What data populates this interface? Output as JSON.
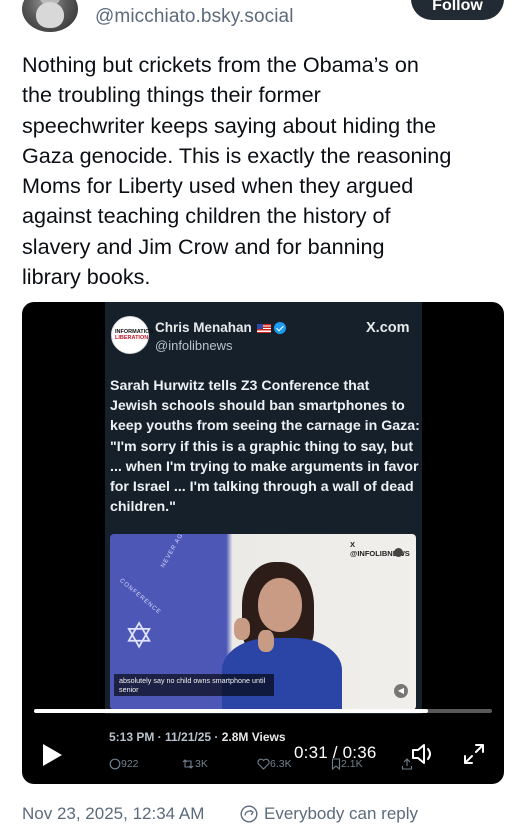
{
  "header": {
    "handle": "@micchiato.bsky.social",
    "follow_label": "Follow"
  },
  "post": {
    "text": "Nothing but crickets from the Obama’s on\nthe troubling things their former\nspeechwriter keeps saying about hiding the\nGaza genocide. This is exactly the reasoning\nMoms for Liberty used when they argued\nagainst teaching children the history of\nslavery and Jim Crow and for banning\nlibrary books."
  },
  "embed": {
    "avatar_line1": "INFORMATION",
    "avatar_line2": "LIBERATION",
    "author_name": "Chris Menahan",
    "author_handle": "@infolibnews",
    "site": "X.com",
    "headline": "Sarah Hurwitz tells Z3 Conference that Jewish schools should ban smartphones to keep youths from seeing the carnage in Gaza: \"I'm sorry if this is a graphic thing to say, but ... when I'm trying to make arguments in favor for Israel ... I'm talking through a wall of dead children.\"",
    "watermark": "X @INFOLIBNEWS",
    "banner_top": "NEVER AGAIN",
    "banner_side": "CONFERENCE",
    "caption": "absolutely say no child owns smartphone until senior",
    "meta_time": "5:13 PM · 11/21/25 · ",
    "meta_views": "2.8M Views",
    "stats": {
      "replies": "922",
      "reposts": "3K",
      "likes": "6.3K",
      "bookmarks": "2.1K"
    }
  },
  "player": {
    "time_display": "0:31 / 0:36",
    "progress_fraction": 0.86,
    "state": "paused",
    "icons": [
      "play-icon",
      "volume-icon",
      "fullscreen-icon"
    ]
  },
  "footer": {
    "date": "Nov 23, 2025, 12:34 AM",
    "reply_setting": "Everybody can reply"
  }
}
